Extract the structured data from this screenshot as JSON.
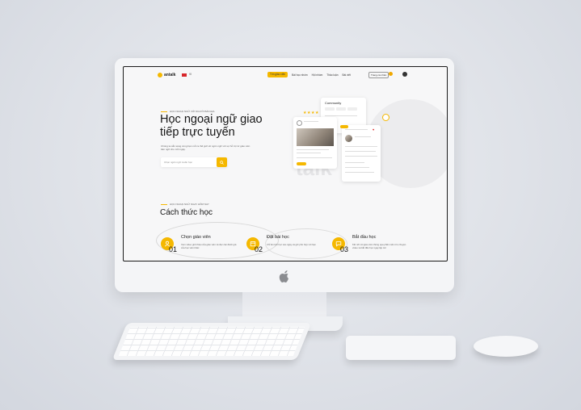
{
  "brand": {
    "logo_text": "antalk",
    "accent": "#f5b800"
  },
  "nav": {
    "language": "VI",
    "items": [
      {
        "label": "Tìm giáo viên",
        "active": true
      },
      {
        "label": "Bài học nhóm",
        "active": false
      },
      {
        "label": "Hội nhóm",
        "active": false
      },
      {
        "label": "Thảo luận",
        "active": false
      },
      {
        "label": "Bài viết",
        "active": false
      }
    ],
    "teacher_button": "Trang cá nhân"
  },
  "hero": {
    "kicker": "HỌC NGOẠI NGỮ VỚI NGƯỜI BẢN ĐỊA",
    "title": "Học ngoại ngữ giao tiếp trực tuyến",
    "description": "Chúng ta sẵn sàng cùng bạn mở ra thế giới về ngôn ngữ với sự hỗ trợ từ giáo viên bản ngữ cho mỗi ngày.",
    "search_placeholder": "Chọn ngôn ngữ muốn học"
  },
  "mockup": {
    "community_title": "Community",
    "watermark": "talk",
    "rating_stars": "★★★★"
  },
  "how": {
    "kicker": "HỌC NGOẠI NGỮ NGAY HÔM NAY",
    "title": "Cách thức học",
    "steps": [
      {
        "number": "01",
        "title": "Chọn giáo viên",
        "desc": "Xem video giới thiệu của giáo viên và đọc các đánh giá của học viên khác",
        "icon": "user-icon"
      },
      {
        "number": "02",
        "title": "Đặt bài học",
        "desc": "Chỉ lên lịch học vào ngày và giờ phù hợp với bạn",
        "icon": "calendar-icon"
      },
      {
        "number": "03",
        "title": "Bắt đầu học",
        "desc": "Kết nối với giáo viên thông qua phần mềm trò chuyện video và bắt đầu học ngay lập tức",
        "icon": "chat-icon"
      }
    ]
  }
}
